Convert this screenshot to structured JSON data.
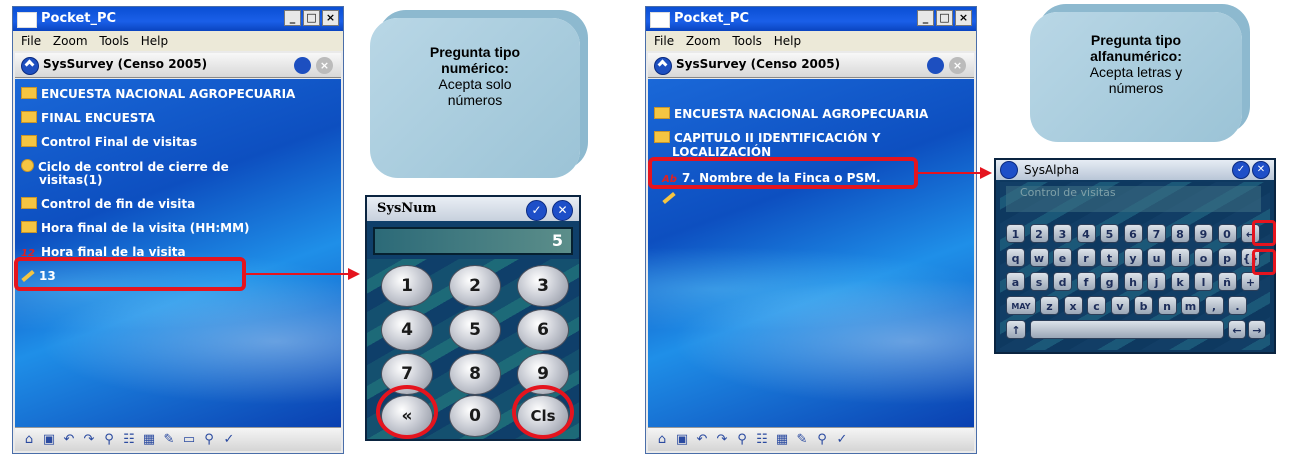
{
  "left_device": {
    "window_title": "Pocket_PC",
    "window_buttons": [
      "_",
      "□",
      "×"
    ],
    "menu": [
      "File",
      "Zoom",
      "Tools",
      "Help"
    ],
    "app_title": "SysSurvey  (Censo 2005)",
    "tree": [
      {
        "icon": "folder-icon",
        "text": "ENCUESTA NACIONAL AGROPECUARIA"
      },
      {
        "icon": "folder-icon",
        "text": "FINAL ENCUESTA"
      },
      {
        "icon": "folder-icon",
        "text": "Control  Final de visitas"
      },
      {
        "icon": "clock-icon",
        "text": "Ciclo  de control  de cierre de"
      },
      {
        "icon": "",
        "text": "visitas(1)"
      },
      {
        "icon": "folder-icon",
        "text": "Control  de fin de visita"
      },
      {
        "icon": "folder-icon",
        "text": "Hora final  de la visita (HH:MM)"
      },
      {
        "icon": "numeric-question-icon",
        "text": "Hora final de la visita"
      },
      {
        "icon": "pencil-icon",
        "text": "13"
      }
    ]
  },
  "callout_numeric": {
    "title": "Pregunta tipo numérico:",
    "body": "Acepta solo números"
  },
  "sysnum": {
    "title": "SysNum",
    "display_value": "5",
    "keys": [
      "1",
      "2",
      "3",
      "4",
      "5",
      "6",
      "7",
      "8",
      "9",
      "«",
      "0",
      "Cls"
    ]
  },
  "right_device": {
    "window_title": "Pocket_PC",
    "window_buttons": [
      "_",
      "□",
      "×"
    ],
    "menu": [
      "File",
      "Zoom",
      "Tools",
      "Help"
    ],
    "app_title": "SysSurvey  (Censo 2005)",
    "tree": [
      {
        "icon": "folder-icon",
        "text": "ENCUESTA NACIONAL AGROPECUARIA"
      },
      {
        "icon": "folder-icon",
        "text": "CAPITULO II  IDENTIFICACIÓN Y"
      },
      {
        "icon": "",
        "text": "LOCALIZACIÓN"
      },
      {
        "icon": "alpha-question-icon",
        "text": "7. Nombre de la Finca o PSM."
      }
    ]
  },
  "callout_alpha": {
    "title": "Pregunta tipo alfanumérico:",
    "body": "Acepta letras y números"
  },
  "sysalpha": {
    "title": "SysAlpha",
    "field_text": "Control  de visitas",
    "row1": [
      "1",
      "2",
      "3",
      "4",
      "5",
      "6",
      "7",
      "8",
      "9",
      "0",
      "←"
    ],
    "row2": [
      "q",
      "w",
      "e",
      "r",
      "t",
      "y",
      "u",
      "i",
      "o",
      "p",
      "{}"
    ],
    "row3": [
      "a",
      "s",
      "d",
      "f",
      "g",
      "h",
      "j",
      "k",
      "l",
      "ñ",
      "+"
    ],
    "row4": [
      "MAY",
      "z",
      "x",
      "c",
      "v",
      "b",
      "n",
      "m",
      ",",
      "."
    ],
    "row5": [
      "↑",
      "",
      "←",
      "→"
    ]
  },
  "colors": {
    "highlight": "#e5141e",
    "callout": "#b9d7e6",
    "screen_blue": "#0d4fc0"
  }
}
